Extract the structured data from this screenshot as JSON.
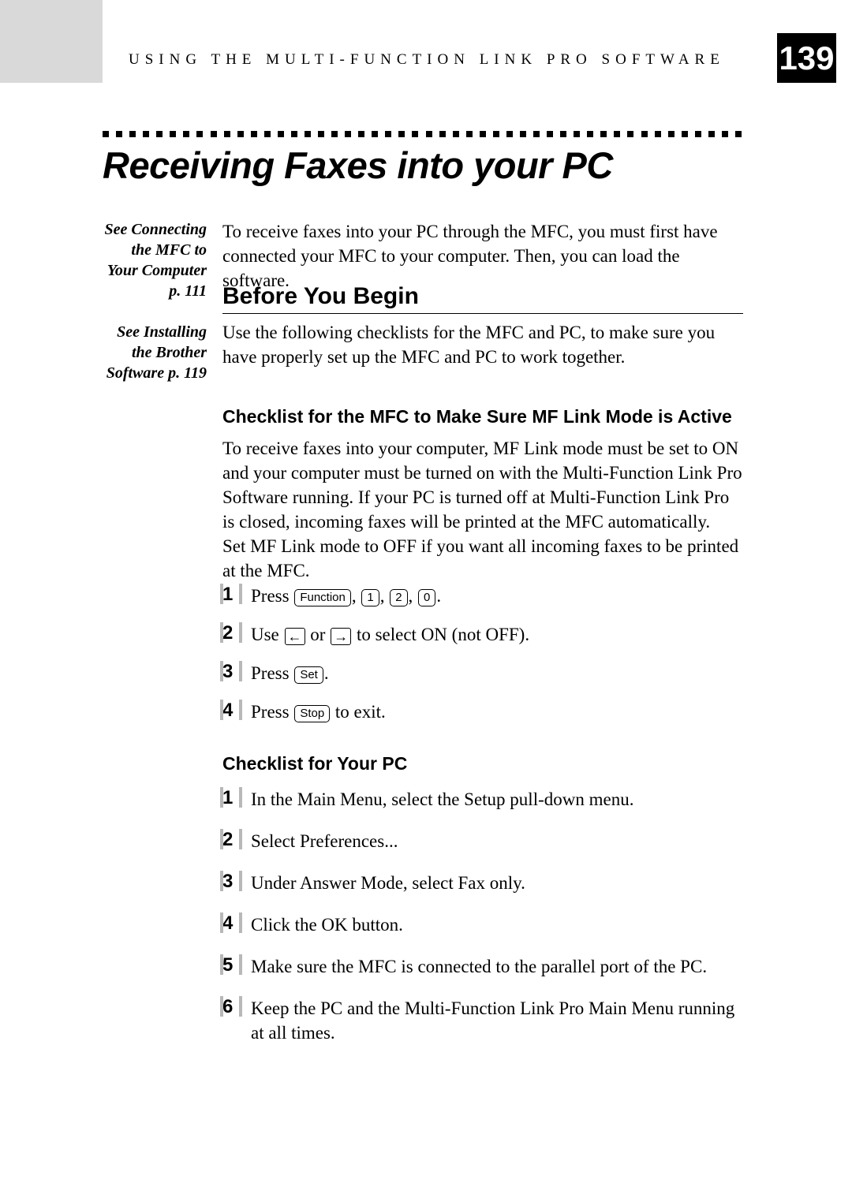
{
  "header": {
    "running_head": "USING THE MULTI-FUNCTION LINK PRO SOFTWARE",
    "page_number": "139"
  },
  "title": "Receiving Faxes into your PC",
  "sidebar": {
    "ref1": "See Connecting the MFC to Your Computer p. 111",
    "ref2": "See Installing the Brother Software p. 119"
  },
  "intro": "To receive faxes into your PC through the MFC, you must first have connected your MFC to your computer. Then, you can load the software.",
  "section1": {
    "heading": "Before You Begin",
    "body": "Use the following checklists for the MFC and PC, to make sure you have properly set up the MFC and PC to work together."
  },
  "checklist1": {
    "heading": "Checklist for the MFC to Make Sure MF Link Mode is Active",
    "para1": "To receive faxes into your computer, MF Link mode must be set to ON and your computer must be turned on with the Multi-Function Link Pro Software running. If your PC is turned off at Multi-Function Link Pro is closed, incoming faxes will be printed at the MFC automatically.",
    "para2": "Set MF Link mode to OFF if you want all incoming faxes to be printed at the MFC.",
    "steps": {
      "s1_prefix": "Press ",
      "s1_keys": [
        "Function",
        "1",
        "2",
        "0"
      ],
      "s2_prefix": "Use ",
      "s2_mid": " or ",
      "s2_suffix": " to select ON (not OFF).",
      "s3_prefix": "Press ",
      "s3_key": "Set",
      "s3_suffix": ".",
      "s4_prefix": "Press ",
      "s4_key": "Stop",
      "s4_suffix": " to exit."
    }
  },
  "checklist2": {
    "heading": "Checklist for Your PC",
    "steps": [
      " In the Main Menu, select the Setup pull-down menu.",
      "Select Preferences...",
      "Under Answer Mode, select Fax only.",
      "Click the OK button.",
      "Make sure the MFC is connected to the parallel port of the PC.",
      "Keep the PC and the Multi-Function Link Pro Main Menu running at all times."
    ]
  },
  "numbers": [
    "1",
    "2",
    "3",
    "4",
    "5",
    "6"
  ]
}
